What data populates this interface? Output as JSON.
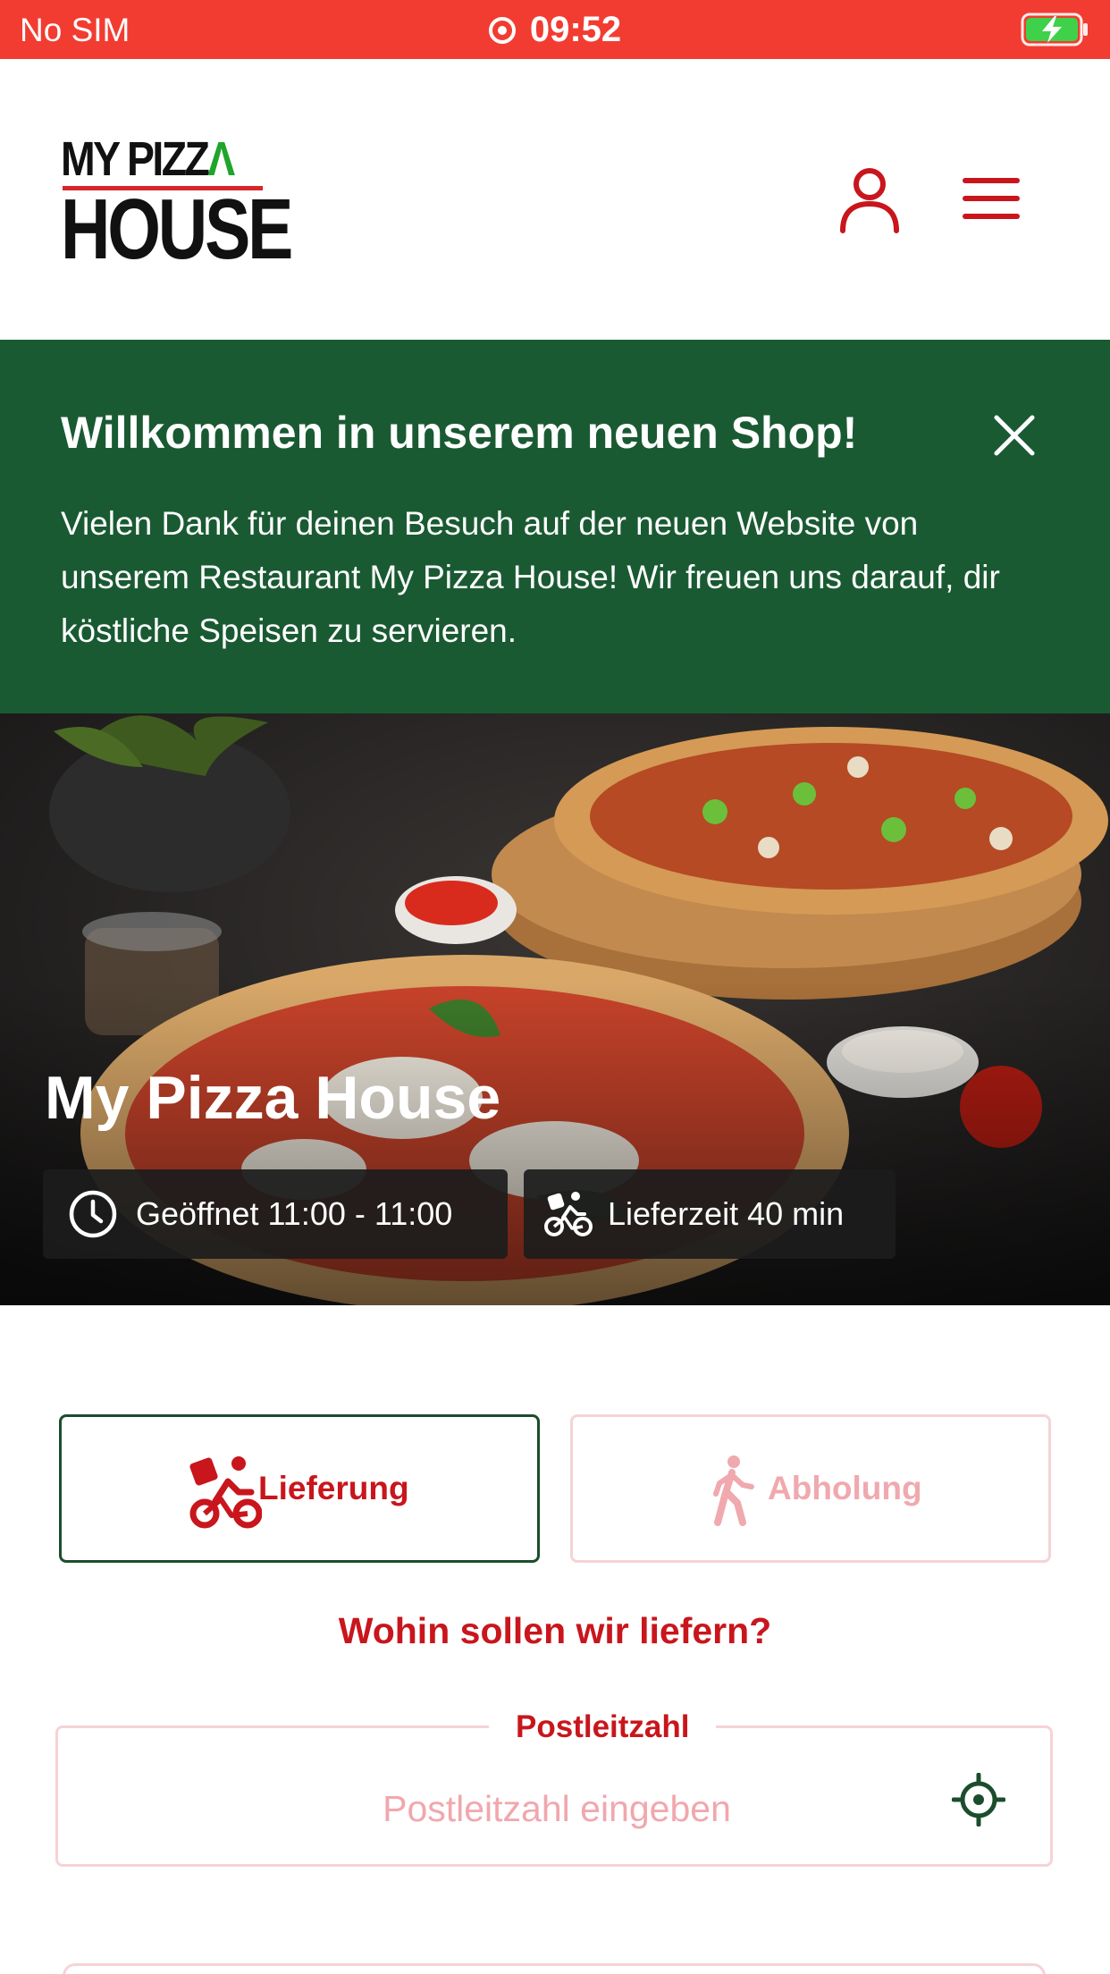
{
  "status_bar": {
    "carrier": "No SIM",
    "time": "09:52",
    "icons": [
      "screen-recording-icon",
      "battery-charging-icon"
    ],
    "background": "#f23c31"
  },
  "header": {
    "logo": {
      "line1": "MY PIZZ",
      "line1_accent": "Λ",
      "line2": "HOUSE"
    },
    "icons": [
      "user-icon",
      "hamburger-menu-icon"
    ],
    "accent": "#c8161c"
  },
  "banner": {
    "title": "Willkommen in unserem neuen Shop!",
    "text": "Vielen Dank für deinen Besuch auf der neuen Website von unserem Restaurant My Pizza House! Wir freuen uns darauf, dir köstliche Speisen zu servieren.",
    "background": "#1a5a33"
  },
  "hero": {
    "title": "My Pizza House",
    "opening_hours": "Geöffnet 11:00 - 11:00",
    "delivery_time": "Lieferzeit 40 min"
  },
  "order_mode": {
    "delivery_label": "Lieferung",
    "pickup_label": "Abholung",
    "selected": "Lieferung"
  },
  "address": {
    "question": "Wohin sollen wir liefern?",
    "postcode_label": "Postleitzahl",
    "postcode_placeholder": "Postleitzahl eingeben",
    "postcode_value": ""
  }
}
